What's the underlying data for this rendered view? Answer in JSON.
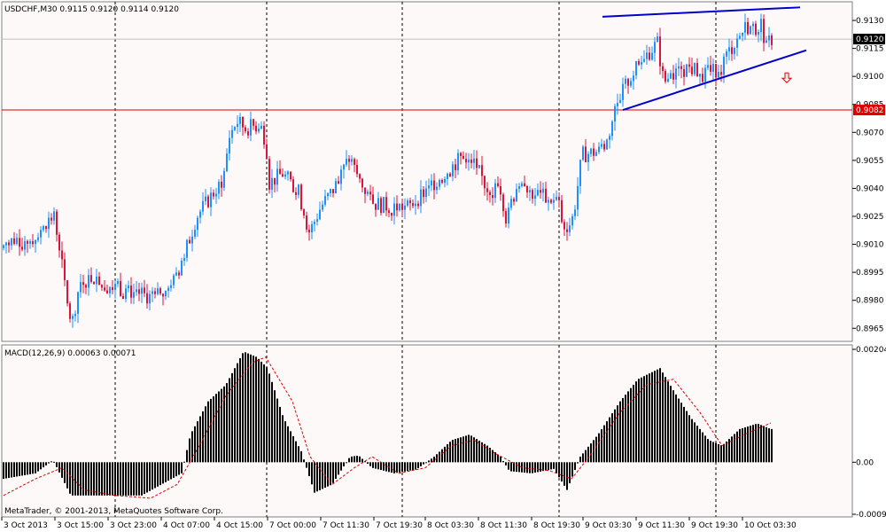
{
  "chart_data": {
    "type": "candlestick",
    "symbol_header": "USDCHF,M30  0.9115 0.9120 0.9114 0.9120",
    "footer_text": "MetaTrader, © 2001-2013, MetaQuotes Software Corp.",
    "price_axis": {
      "ylim": [
        0.8958,
        0.914
      ],
      "ticks": [
        "0.9130",
        "0.9115",
        "0.9100",
        "0.9085",
        "0.9070",
        "0.9055",
        "0.9040",
        "0.9025",
        "0.9010",
        "0.8995",
        "0.8980",
        "0.8965"
      ]
    },
    "time_axis": [
      "3 Oct 2013",
      "3 Oct 15:00",
      "3 Oct 23:00",
      "4 Oct 07:00",
      "4 Oct 15:00",
      "7 Oct 00:00",
      "7 Oct 11:30",
      "7 Oct 19:30",
      "8 Oct 03:30",
      "8 Oct 11:30",
      "8 Oct 19:30",
      "9 Oct 03:30",
      "9 Oct 11:30",
      "9 Oct 19:30",
      "10 Oct 03:30"
    ],
    "current_price": "0.9120",
    "horizontal_level": "0.9082",
    "colors": {
      "bull": "#1e90ff",
      "bear": "#dc143c",
      "trendline": "#0000cd",
      "level_line": "#e00000",
      "macd_hist": "#000000",
      "signal": "#e00000"
    },
    "trendlines": [
      {
        "name": "upper",
        "from": [
          680,
          0.9132
        ],
        "to": [
          903,
          0.9137
        ]
      },
      {
        "name": "lower",
        "from": [
          703,
          0.9082
        ],
        "to": [
          910,
          0.9114
        ]
      }
    ],
    "sell_arrow": {
      "icon": "down-arrow",
      "bar": 888,
      "price": 0.9099
    },
    "macd": {
      "label": "MACD(12,26,9) 0.00063 0.00071",
      "ylim": [
        -0.00094,
        0.00204
      ],
      "ticks": [
        "0.00204",
        "0.00",
        "-0.00094"
      ],
      "points": [
        [
          4,
          -0.0003
        ],
        [
          40,
          -0.0002
        ],
        [
          60,
          4e-05
        ],
        [
          80,
          -0.0006
        ],
        [
          110,
          -0.0006
        ],
        [
          160,
          -0.0006
        ],
        [
          205,
          -0.0002
        ],
        [
          215,
          0.0005
        ],
        [
          235,
          0.0011
        ],
        [
          255,
          0.0014
        ],
        [
          275,
          0.002
        ],
        [
          290,
          0.0019
        ],
        [
          302,
          0.0017
        ],
        [
          320,
          0.0008
        ],
        [
          340,
          0.0002
        ],
        [
          355,
          -0.00055
        ],
        [
          375,
          -0.0004
        ],
        [
          395,
          0.0001
        ],
        [
          405,
          0.00012
        ],
        [
          420,
          -0.0001
        ],
        [
          445,
          -0.0002
        ],
        [
          470,
          -0.00013
        ],
        [
          490,
          0.0001
        ],
        [
          510,
          0.0004
        ],
        [
          530,
          0.0005
        ],
        [
          550,
          0.0003
        ],
        [
          565,
          0.0001
        ],
        [
          575,
          -0.00016
        ],
        [
          600,
          -0.0002
        ],
        [
          625,
          -0.00012
        ],
        [
          640,
          -0.0005
        ],
        [
          655,
          0.0001
        ],
        [
          675,
          0.0005
        ],
        [
          700,
          0.0011
        ],
        [
          720,
          0.0015
        ],
        [
          745,
          0.0017
        ],
        [
          760,
          0.0013
        ],
        [
          780,
          0.0008
        ],
        [
          800,
          0.0004
        ],
        [
          815,
          0.0003
        ],
        [
          835,
          0.0006
        ],
        [
          855,
          0.0007
        ],
        [
          870,
          0.0006
        ]
      ],
      "signal": [
        [
          4,
          -0.0006
        ],
        [
          40,
          -0.0003
        ],
        [
          70,
          -0.0001
        ],
        [
          95,
          -0.0005
        ],
        [
          130,
          -0.0006
        ],
        [
          170,
          -0.00065
        ],
        [
          200,
          -0.0004
        ],
        [
          225,
          0.0003
        ],
        [
          255,
          0.0012
        ],
        [
          285,
          0.0018
        ],
        [
          300,
          0.0019
        ],
        [
          330,
          0.0011
        ],
        [
          350,
          0.0001
        ],
        [
          375,
          -0.0004
        ],
        [
          400,
          -0.0001
        ],
        [
          420,
          0.0001
        ],
        [
          450,
          -0.0002
        ],
        [
          480,
          -0.0001
        ],
        [
          510,
          0.0003
        ],
        [
          535,
          0.0004
        ],
        [
          560,
          0.00015
        ],
        [
          590,
          -0.0001
        ],
        [
          620,
          -0.00015
        ],
        [
          645,
          -0.0003
        ],
        [
          665,
          0.0001
        ],
        [
          700,
          0.0009
        ],
        [
          730,
          0.0014
        ],
        [
          760,
          0.0015
        ],
        [
          790,
          0.0009
        ],
        [
          815,
          0.0003
        ],
        [
          840,
          0.0005
        ],
        [
          870,
          0.00071
        ]
      ]
    },
    "price_path": [
      [
        4,
        0.9008
      ],
      [
        20,
        0.9013
      ],
      [
        40,
        0.9012
      ],
      [
        55,
        0.902
      ],
      [
        63,
        0.9027
      ],
      [
        70,
        0.901
      ],
      [
        78,
        0.898
      ],
      [
        84,
        0.8967
      ],
      [
        93,
        0.899
      ],
      [
        110,
        0.8993
      ],
      [
        130,
        0.8987
      ],
      [
        150,
        0.8985
      ],
      [
        170,
        0.8982
      ],
      [
        185,
        0.8982
      ],
      [
        200,
        0.8991
      ],
      [
        215,
        0.901
      ],
      [
        225,
        0.9025
      ],
      [
        240,
        0.9035
      ],
      [
        255,
        0.9045
      ],
      [
        262,
        0.9068
      ],
      [
        270,
        0.9076
      ],
      [
        280,
        0.9072
      ],
      [
        295,
        0.9074
      ],
      [
        303,
        0.9066
      ],
      [
        307,
        0.9043
      ],
      [
        322,
        0.9048
      ],
      [
        340,
        0.9038
      ],
      [
        352,
        0.9016
      ],
      [
        365,
        0.903
      ],
      [
        380,
        0.904
      ],
      [
        397,
        0.9056
      ],
      [
        410,
        0.9043
      ],
      [
        425,
        0.9032
      ],
      [
        445,
        0.903
      ],
      [
        465,
        0.903
      ],
      [
        485,
        0.904
      ],
      [
        505,
        0.9048
      ],
      [
        527,
        0.9058
      ],
      [
        540,
        0.9053
      ],
      [
        552,
        0.904
      ],
      [
        568,
        0.904
      ],
      [
        575,
        0.9022
      ],
      [
        585,
        0.9042
      ],
      [
        600,
        0.9038
      ],
      [
        620,
        0.9035
      ],
      [
        633,
        0.9033
      ],
      [
        640,
        0.9015
      ],
      [
        650,
        0.9025
      ],
      [
        660,
        0.9058
      ],
      [
        680,
        0.906
      ],
      [
        688,
        0.9065
      ],
      [
        697,
        0.9082
      ],
      [
        703,
        0.909
      ],
      [
        715,
        0.91
      ],
      [
        730,
        0.911
      ],
      [
        745,
        0.9118
      ],
      [
        752,
        0.9097
      ],
      [
        768,
        0.9102
      ],
      [
        778,
        0.9105
      ],
      [
        790,
        0.9103
      ],
      [
        800,
        0.91
      ],
      [
        815,
        0.9105
      ],
      [
        828,
        0.9115
      ],
      [
        845,
        0.9127
      ],
      [
        855,
        0.9125
      ],
      [
        862,
        0.9128
      ],
      [
        868,
        0.9115
      ],
      [
        872,
        0.912
      ]
    ],
    "spikes": [
      [
        745,
        0.9133
      ],
      [
        779,
        0.9132
      ],
      [
        863,
        0.9131
      ],
      [
        80,
        0.8967
      ],
      [
        83,
        0.8962
      ]
    ]
  }
}
